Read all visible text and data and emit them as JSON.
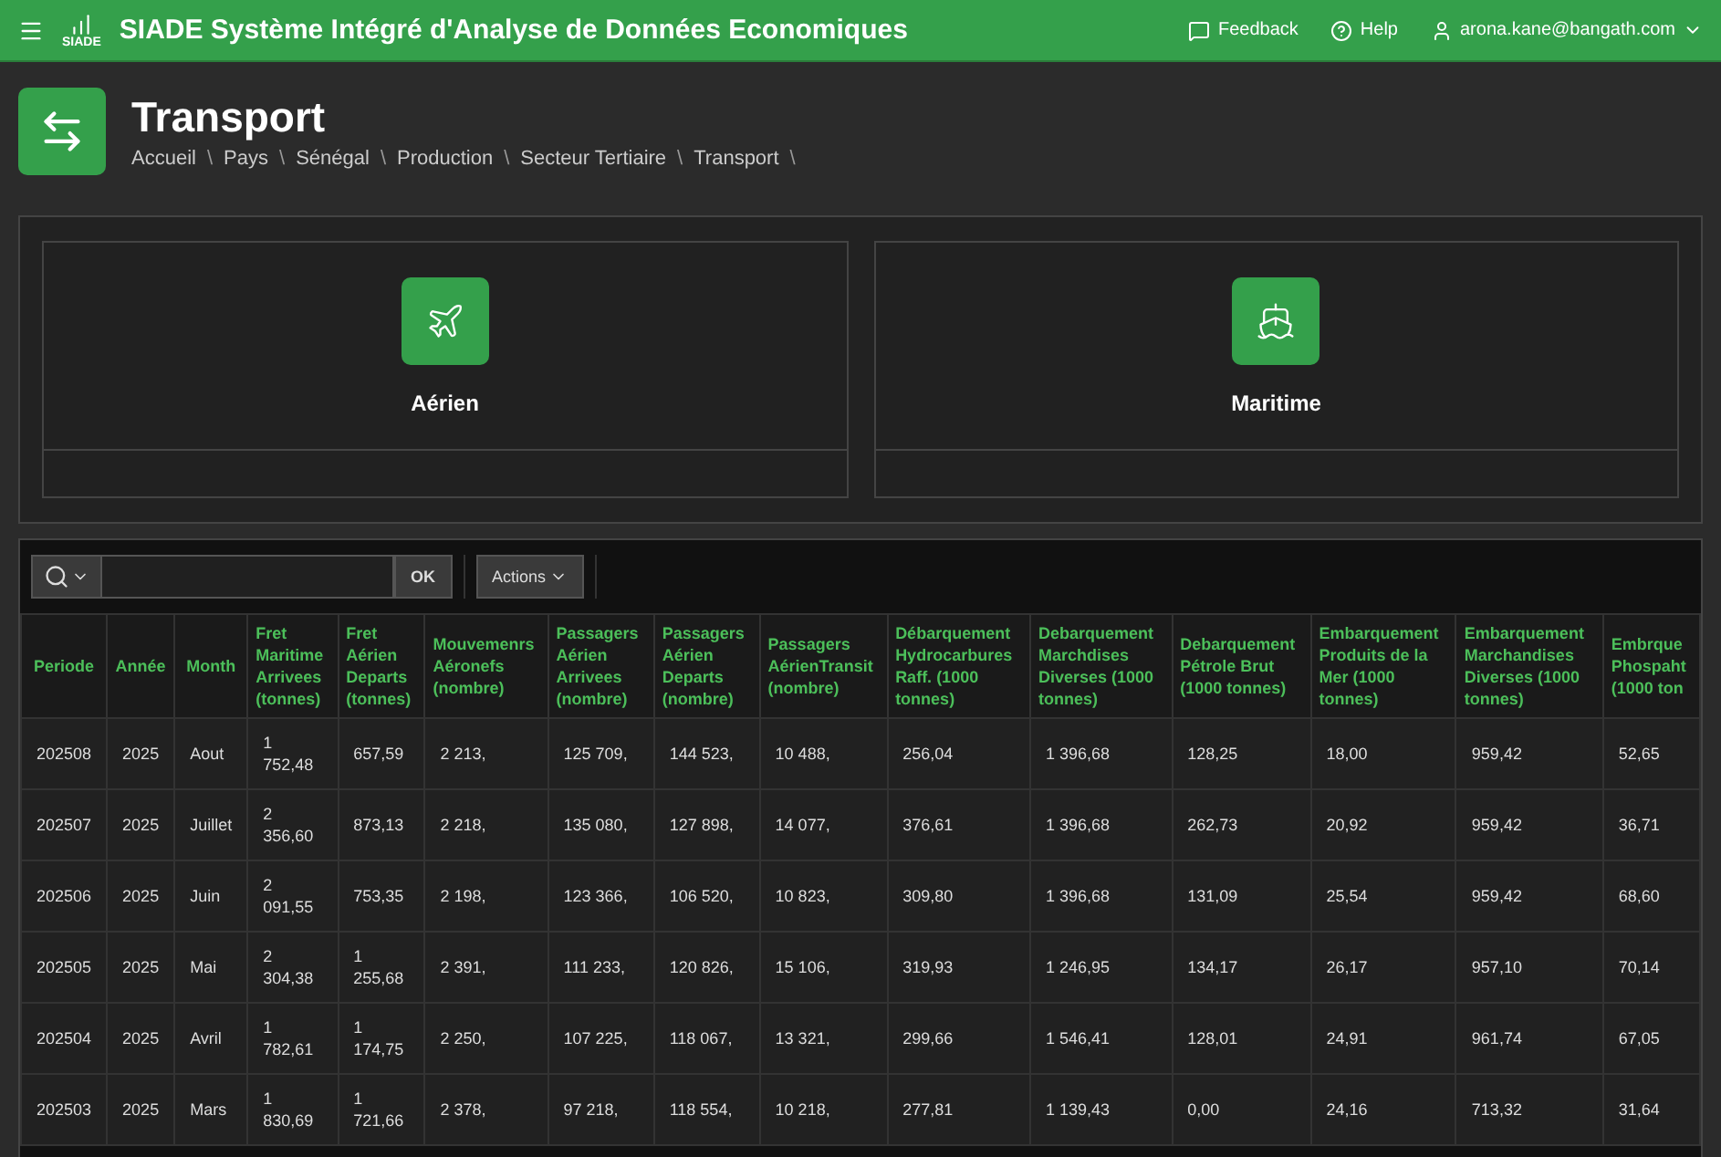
{
  "topbar": {
    "logo_text": "SIADE",
    "title": "SIADE Système Intégré d'Analyse de Données Economiques",
    "links": [
      {
        "kind": "feedback",
        "label": "Feedback"
      },
      {
        "kind": "help",
        "label": "Help"
      }
    ],
    "user": "arona.kane@bangath.com"
  },
  "page": {
    "title": "Transport",
    "separator": "\\",
    "breadcrumb": [
      "Accueil",
      "Pays",
      "Sénégal",
      "Production",
      "Secteur Tertiaire",
      "Transport"
    ]
  },
  "cards": [
    {
      "kind": "plane",
      "label": "Aérien"
    },
    {
      "kind": "ship",
      "label": "Maritime"
    }
  ],
  "toolbar": {
    "go": "OK",
    "actions": "Actions"
  },
  "table": {
    "columns": [
      "Periode",
      "Année",
      "Month",
      "Fret Maritime Arrivees (tonnes)",
      "Fret Aérien Departs (tonnes)",
      "Mouvemenrs Aéronefs (nombre)",
      "Passagers Aérien Arrivees (nombre)",
      "Passagers Aérien Departs (nombre)",
      "Passagers AérienTransit (nombre)",
      "Débarquement Hydrocarbures Raff. (1000 tonnes)",
      "Debarquement Marchdises Diverses (1000 tonnes)",
      "Debarquement Pétrole Brut (1000 tonnes)",
      "Embarquement Produits de la Mer (1000 tonnes)",
      "Embarquement Marchandises Diverses (1000 tonnes)",
      "Embrque Phospaht (1000 ton"
    ],
    "rows": [
      [
        "202508",
        "2025",
        "Aout",
        "1 752,48",
        "657,59",
        "2 213,",
        "125 709,",
        "144 523,",
        "10 488,",
        "256,04",
        "1 396,68",
        "128,25",
        "18,00",
        "959,42",
        "52,65"
      ],
      [
        "202507",
        "2025",
        "Juillet",
        "2 356,60",
        "873,13",
        "2 218,",
        "135 080,",
        "127 898,",
        "14 077,",
        "376,61",
        "1 396,68",
        "262,73",
        "20,92",
        "959,42",
        "36,71"
      ],
      [
        "202506",
        "2025",
        "Juin",
        "2 091,55",
        "753,35",
        "2 198,",
        "123 366,",
        "106 520,",
        "10 823,",
        "309,80",
        "1 396,68",
        "131,09",
        "25,54",
        "959,42",
        "68,60"
      ],
      [
        "202505",
        "2025",
        "Mai",
        "2 304,38",
        "1 255,68",
        "2 391,",
        "111 233,",
        "120 826,",
        "15 106,",
        "319,93",
        "1 246,95",
        "134,17",
        "26,17",
        "957,10",
        "70,14"
      ],
      [
        "202504",
        "2025",
        "Avril",
        "1 782,61",
        "1 174,75",
        "2 250,",
        "107 225,",
        "118 067,",
        "13 321,",
        "299,66",
        "1 546,41",
        "128,01",
        "24,91",
        "961,74",
        "67,05"
      ],
      [
        "202503",
        "2025",
        "Mars",
        "1 830,69",
        "1 721,66",
        "2 378,",
        "97 218,",
        "118 554,",
        "10 218,",
        "277,81",
        "1 139,43",
        "0,00",
        "24,16",
        "713,32",
        "31,64"
      ]
    ]
  }
}
